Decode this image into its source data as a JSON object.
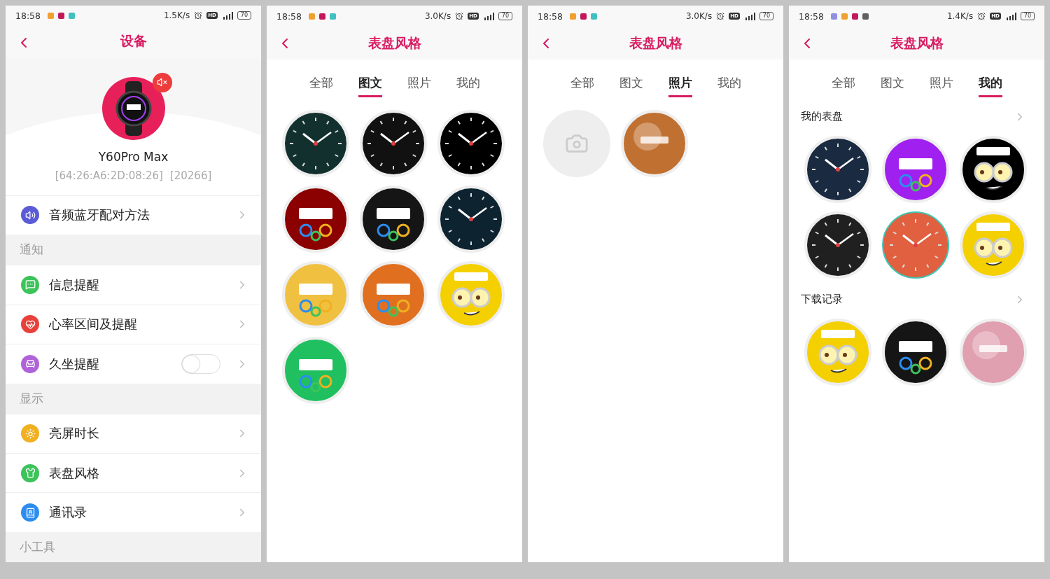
{
  "screens": [
    {
      "kind": "device",
      "status": {
        "time": "18:58",
        "apps": [
          {
            "color": "#f0a030"
          },
          {
            "color": "#c2185b"
          },
          {
            "color": "#40c0c0"
          }
        ],
        "speed": "1.5K/s",
        "hd": "HD",
        "battery": "70"
      },
      "title": "设备",
      "device": {
        "name": "Y60Pro Max",
        "address": "[64:26:A6:2D:08:26]",
        "code": "[20266]",
        "muted": true
      },
      "list": [
        {
          "kind": "row",
          "label": "音频蓝牙配对方法",
          "color": "#5b5bd6"
        },
        {
          "kind": "section",
          "label": "通知"
        },
        {
          "kind": "row",
          "label": "信息提醒",
          "color": "#3cc35a"
        },
        {
          "kind": "row",
          "label": "心率区间及提醒",
          "color": "#e8403a"
        },
        {
          "kind": "toggle",
          "label": "久坐提醒",
          "color": "#b062d8",
          "on": false
        },
        {
          "kind": "section",
          "label": "显示"
        },
        {
          "kind": "row",
          "label": "亮屏时长",
          "color": "#f0b020"
        },
        {
          "kind": "row",
          "label": "表盘风格",
          "color": "#3cc35a"
        },
        {
          "kind": "row",
          "label": "通讯录",
          "color": "#2d8cf0"
        },
        {
          "kind": "section",
          "label": "小工具"
        }
      ]
    },
    {
      "kind": "faces",
      "status": {
        "time": "18:58",
        "apps": [
          {
            "color": "#f0a030"
          },
          {
            "color": "#c2185b"
          },
          {
            "color": "#40c0c0"
          }
        ],
        "speed": "3.0K/s",
        "hd": "HD",
        "battery": "70"
      },
      "title": "表盘风格",
      "tabs": [
        {
          "label": "全部",
          "selected": false
        },
        {
          "label": "图文",
          "selected": true
        },
        {
          "label": "照片",
          "selected": false
        },
        {
          "label": "我的",
          "selected": false
        }
      ],
      "groups": [
        {
          "faces": [
            {
              "kind": "analog",
              "color": "#12302e"
            },
            {
              "kind": "analog",
              "color": "#111111"
            },
            {
              "kind": "analog",
              "color": "#000000"
            },
            {
              "kind": "digital",
              "color": "#8b0000"
            },
            {
              "kind": "digital",
              "color": "#151515"
            },
            {
              "kind": "analog",
              "color": "#0d2430"
            },
            {
              "kind": "digital",
              "color": "#f0c040"
            },
            {
              "kind": "digital",
              "color": "#e07020"
            },
            {
              "kind": "cartoon",
              "color": "#f5d000"
            },
            {
              "kind": "digital",
              "color": "#20c060"
            }
          ]
        }
      ]
    },
    {
      "kind": "faces",
      "status": {
        "time": "18:58",
        "apps": [
          {
            "color": "#f0a030"
          },
          {
            "color": "#c2185b"
          },
          {
            "color": "#40c0c0"
          }
        ],
        "speed": "3.0K/s",
        "hd": "HD",
        "battery": "70"
      },
      "title": "表盘风格",
      "tabs": [
        {
          "label": "全部",
          "selected": false
        },
        {
          "label": "图文",
          "selected": false
        },
        {
          "label": "照片",
          "selected": true
        },
        {
          "label": "我的",
          "selected": false
        }
      ],
      "groups": [
        {
          "faces": [
            {
              "kind": "add",
              "color": "#eeeeee"
            },
            {
              "kind": "photo",
              "color": "#c07030"
            }
          ]
        }
      ]
    },
    {
      "kind": "faces",
      "status": {
        "time": "18:58",
        "apps": [
          {
            "color": "#9090e0"
          },
          {
            "color": "#f0a030"
          },
          {
            "color": "#c2185b"
          },
          {
            "color": "#606060"
          }
        ],
        "speed": "1.4K/s",
        "hd": "HD",
        "battery": "70"
      },
      "title": "表盘风格",
      "tabs": [
        {
          "label": "全部",
          "selected": false
        },
        {
          "label": "图文",
          "selected": false
        },
        {
          "label": "照片",
          "selected": false
        },
        {
          "label": "我的",
          "selected": true
        }
      ],
      "groups": [
        {
          "title": "我的表盘",
          "faces": [
            {
              "kind": "analog",
              "color": "#1a2a40",
              "selected": false
            },
            {
              "kind": "digital",
              "color": "#a020f0",
              "selected": false
            },
            {
              "kind": "cartoon",
              "color": "#000000",
              "selected": false
            },
            {
              "kind": "analog",
              "color": "#202020",
              "selected": false
            },
            {
              "kind": "analog",
              "color": "#e06040",
              "selected": true
            },
            {
              "kind": "cartoon",
              "color": "#f5d000",
              "selected": false
            }
          ]
        },
        {
          "title": "下载记录",
          "faces": [
            {
              "kind": "cartoon",
              "color": "#f5d000"
            },
            {
              "kind": "digital",
              "color": "#151515"
            },
            {
              "kind": "photo",
              "color": "#e0a0b0"
            }
          ]
        }
      ]
    }
  ]
}
